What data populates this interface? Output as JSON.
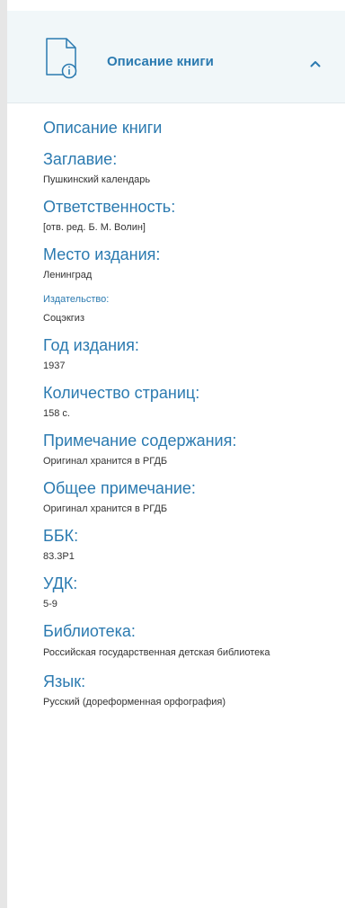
{
  "header": {
    "title": "Описание книги",
    "icon": "document-info-icon",
    "chevron": "chevron-up-icon",
    "accent_color": "#2b7ab0",
    "background_color": "#f1f7f9"
  },
  "section_title": "Описание книги",
  "fields": [
    {
      "label": "Заглавие:",
      "value": "Пушкинский календарь",
      "small": false
    },
    {
      "label": "Ответственность:",
      "value": "[отв. ред. Б. М. Волин]",
      "small": false
    },
    {
      "label": "Место издания:",
      "value": "Ленинград",
      "small": false
    },
    {
      "label": "Издательство:",
      "value": "Соцэкгиз",
      "small": true
    },
    {
      "label": "Год издания:",
      "value": "1937",
      "small": false
    },
    {
      "label": "Количество страниц:",
      "value": "158 с.",
      "small": false
    },
    {
      "label": "Примечание содержания:",
      "value": "Оригинал хранится в РГДБ",
      "small": false
    },
    {
      "label": "Общее примечание:",
      "value": "Оригинал хранится в РГДБ",
      "small": false
    },
    {
      "label": "ББК:",
      "value": "83.3Р1",
      "small": false
    },
    {
      "label": "УДК:",
      "value": "5-9",
      "small": false
    },
    {
      "label": "Библиотека:",
      "value": "Российская государственная детская библиотека",
      "small": false,
      "multi": true
    },
    {
      "label": "Язык:",
      "value": "Русский (дореформенная орфография)",
      "small": false
    }
  ]
}
